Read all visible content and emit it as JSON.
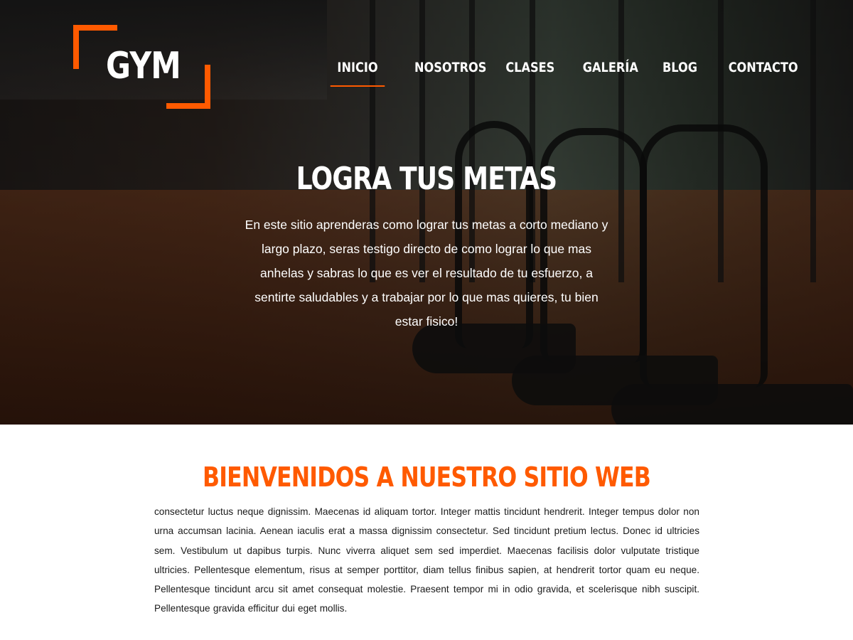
{
  "brand": {
    "logo_text": "GYM",
    "accent_color": "#ff5a00"
  },
  "nav": {
    "items": [
      {
        "label": "INICIO",
        "active": true
      },
      {
        "label": "NOSOTROS",
        "active": false
      },
      {
        "label": "CLASES",
        "active": false
      },
      {
        "label": "GALERÍA",
        "active": false
      },
      {
        "label": "BLOG",
        "active": false
      },
      {
        "label": "CONTACTO",
        "active": false
      }
    ]
  },
  "hero": {
    "title": "LOGRA TUS METAS",
    "text": "En este sitio aprenderas como lograr tus metas a corto mediano y largo plazo, seras testigo directo de como lograr lo que mas anhelas y sabras lo que es ver el resultado de tu esfuerzo, a sentirte saludables y a trabajar por lo que mas quieres, tu bien estar fisico!"
  },
  "welcome": {
    "title": "BIENVENIDOS A NUESTRO SITIO WEB",
    "text": "consectetur luctus neque dignissim. Maecenas id aliquam tortor. Integer mattis tincidunt hendrerit. Integer tempus dolor non urna accumsan lacinia. Aenean iaculis erat a massa dignissim consectetur. Sed tincidunt pretium lectus. Donec id ultricies sem. Vestibulum ut dapibus turpis. Nunc viverra aliquet sem sed imperdiet. Maecenas facilisis dolor vulputate tristique ultricies. Pellentesque elementum, risus at semper porttitor, diam tellus finibus sapien, at hendrerit tortor quam eu neque. Pellentesque tincidunt arcu sit amet consequat molestie. Praesent tempor mi in odio gravida, et scelerisque nibh suscipit. Pellentesque gravida efficitur dui eget mollis."
  }
}
